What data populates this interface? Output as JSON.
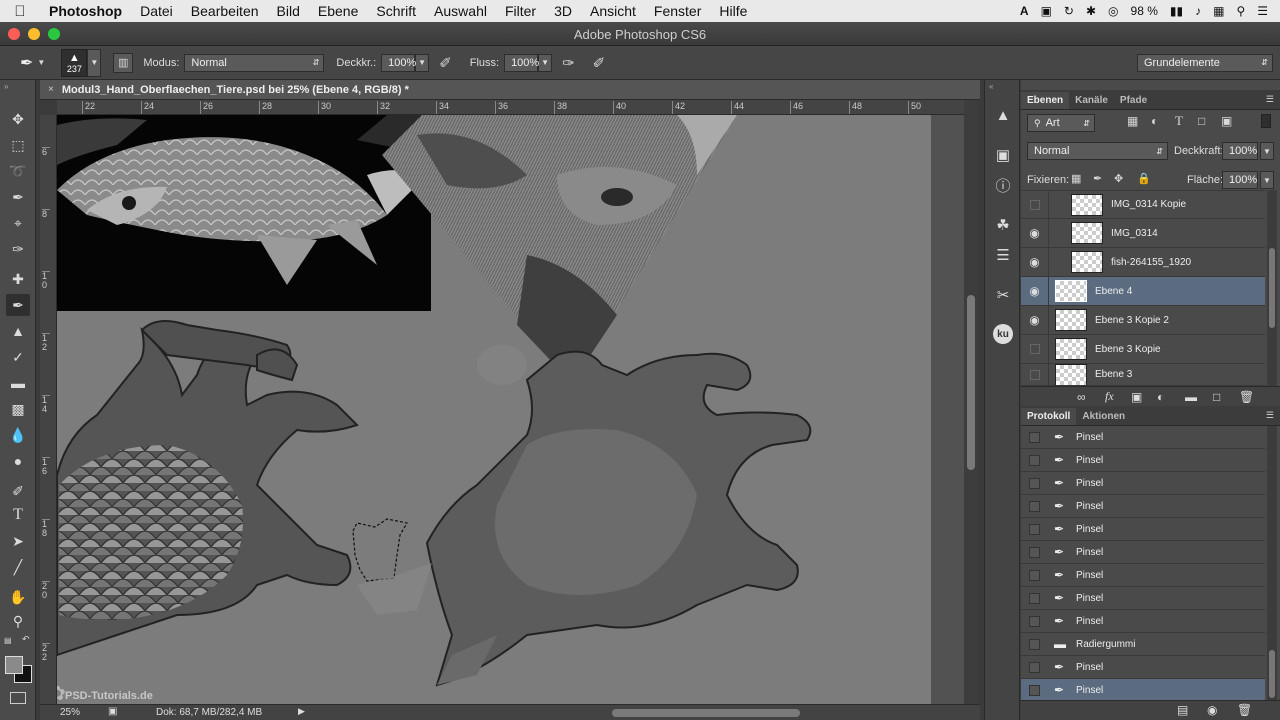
{
  "menubar": {
    "app": "Photoshop",
    "items": [
      "Datei",
      "Bearbeiten",
      "Bild",
      "Ebene",
      "Schrift",
      "Auswahl",
      "Filter",
      "3D",
      "Ansicht",
      "Fenster",
      "Hilfe"
    ],
    "battery": "98 %"
  },
  "window": {
    "title": "Adobe Photoshop CS6"
  },
  "options": {
    "brush_size": "237",
    "mode_label": "Modus:",
    "mode_value": "Normal",
    "opacity_label": "Deckkr.:",
    "opacity_value": "100%",
    "flow_label": "Fluss:",
    "flow_value": "100%",
    "workspace": "Grundelemente"
  },
  "document": {
    "tab_title": "Modul3_Hand_Oberflaechen_Tiere.psd bei 25% (Ebene 4, RGB/8) *",
    "ruler_h": [
      "22",
      "24",
      "26",
      "28",
      "30",
      "32",
      "34",
      "36",
      "38",
      "40",
      "42",
      "44",
      "46",
      "48",
      "50"
    ],
    "ruler_v": [
      "6",
      "8",
      "1 0",
      "1 2",
      "1 4",
      "1 6",
      "1 8",
      "2 0",
      "2 2"
    ],
    "zoom": "25%",
    "doc_size": "Dok: 68,7 MB/282,4 MB",
    "watermark": "PSD-Tutorials.de"
  },
  "layers_panel": {
    "tabs": [
      "Ebenen",
      "Kanäle",
      "Pfade"
    ],
    "filter_kind": "Art",
    "blend_mode": "Normal",
    "opacity_label": "Deckkraft:",
    "opacity_value": "100%",
    "lock_label": "Fixieren:",
    "fill_label": "Fläche:",
    "fill_value": "100%",
    "layers": [
      {
        "name": "IMG_0314 Kopie",
        "visible": false
      },
      {
        "name": "IMG_0314",
        "visible": true
      },
      {
        "name": "fish-264155_1920",
        "visible": true
      },
      {
        "name": "Ebene 4",
        "visible": true,
        "selected": true
      },
      {
        "name": "Ebene 3 Kopie 2",
        "visible": true
      },
      {
        "name": "Ebene 3 Kopie",
        "visible": false
      },
      {
        "name": "Ebene 3",
        "visible": false
      }
    ]
  },
  "history_panel": {
    "tabs": [
      "Protokoll",
      "Aktionen"
    ],
    "items": [
      "Pinsel",
      "Pinsel",
      "Pinsel",
      "Pinsel",
      "Pinsel",
      "Pinsel",
      "Pinsel",
      "Pinsel",
      "Pinsel",
      "Radiergummi",
      "Pinsel",
      "Pinsel"
    ]
  },
  "dock": {
    "ku_label": "ku"
  }
}
